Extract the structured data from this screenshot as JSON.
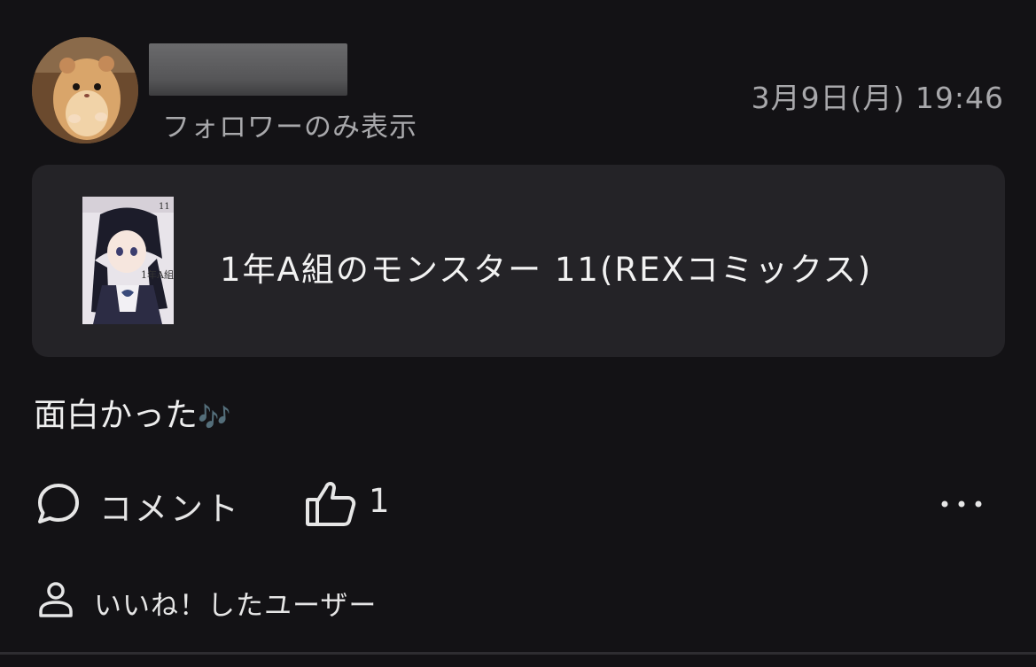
{
  "post": {
    "visibility": "フォロワーのみ表示",
    "timestamp": "3月9日(月) 19:46",
    "book": {
      "title": "1年A組のモンスター 11(REXコミックス)"
    },
    "body": {
      "text": "面白かった",
      "emoji": "🎶"
    }
  },
  "actions": {
    "comment_label": "コメント",
    "like_count": "1",
    "more_icon": "more-horizontal-icon"
  },
  "liked_users": {
    "label": "いいね！したユーザー",
    "icon": "user-icon"
  },
  "colors": {
    "background": "#131215",
    "card": "#242327",
    "text": "#ececec",
    "muted": "#a8a8ab"
  }
}
